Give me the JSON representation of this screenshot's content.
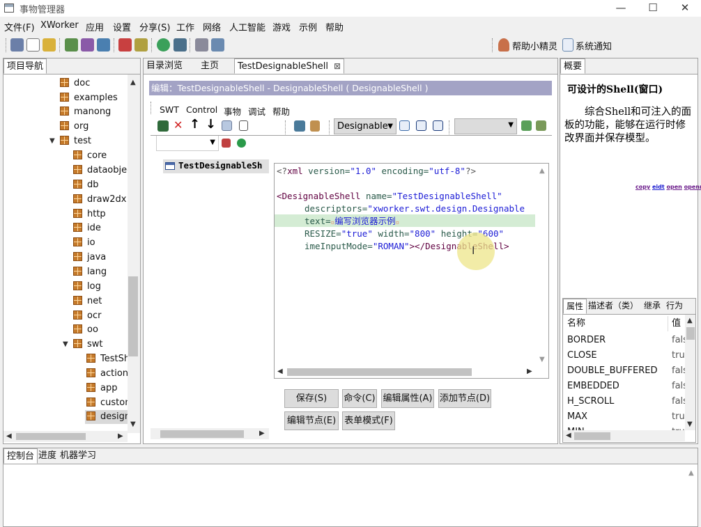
{
  "app_title": "事物管理器",
  "window_controls": {
    "minimize": "—",
    "maximize": "☐",
    "close": "✕"
  },
  "menu": [
    "文件(F)",
    "XWorker",
    "应用",
    "设置",
    "分享(S)",
    "工作",
    "网络",
    "人工智能",
    "游戏",
    "示例",
    "帮助"
  ],
  "toolbar_right": {
    "helper": "帮助小精灵",
    "notify": "系统通知"
  },
  "left_panel": {
    "tab": "项目导航",
    "tree": [
      "doc",
      "examples",
      "manong",
      "org",
      "test",
      "core",
      "dataobjec",
      "db",
      "draw2dx",
      "http",
      "ide",
      "io",
      "java",
      "lang",
      "log",
      "net",
      "ocr",
      "oo",
      "swt",
      "TestSh",
      "actions",
      "app",
      "custon",
      "design"
    ]
  },
  "center": {
    "tabs": [
      "目录浏览",
      "主页",
      "TestDesignableShell"
    ],
    "edit_header": "编辑：TestDesignableShell - DesignableShell ( DesignableShell )",
    "editor_menu": [
      "SWT",
      "Control",
      "事物",
      "调试",
      "帮助"
    ],
    "combo_value": "Designable",
    "outline_node": "TestDesignableSh",
    "xml_lines": {
      "l1": [
        "<?",
        "xml",
        " version=",
        "\"1.0\"",
        " encoding=",
        "\"utf-8\"",
        "?>"
      ],
      "l2_tag": "<DesignableShell",
      "l2_attr": " name=",
      "l2_val": "\"TestDesignableShell\"",
      "l3_attr": "descriptors=",
      "l3_val": "\"xworker.swt.design.Designable",
      "l4_attr": "text=",
      "l4_val": "编写浏览器示例",
      "l5_attr1": "RESIZE=",
      "l5_val1": "\"true\"",
      "l5_attr2": " width=",
      "l5_val2": "\"800\"",
      "l5_attr3": " height=",
      "l5_val3": "\"600\"",
      "l6_attr": "imeInputMode=",
      "l6_val": "\"ROMAN\"",
      "l6_close": "></DesignableShell>"
    },
    "buttons": {
      "save": "保存(S)",
      "command": "命令(C)",
      "edit_props": "编辑属性(A)",
      "add_node": "添加节点(D)",
      "edit_node": "编辑节点(E)",
      "form_mode": "表单模式(F)"
    }
  },
  "right_panel": {
    "tab": "概要",
    "title": "可设计的Shell(窗口)",
    "description": "综合Shell和可注入的面板的功能，能够在运行时修改界面并保存模型。",
    "links": [
      "copy",
      "eidt",
      "open",
      "openr"
    ],
    "prop_tabs": [
      "属性",
      "描述者（类）",
      "继承",
      "行为"
    ],
    "prop_headers": {
      "name": "名称",
      "value": "值"
    },
    "props": [
      {
        "name": "BORDER",
        "value": "false"
      },
      {
        "name": "CLOSE",
        "value": "true"
      },
      {
        "name": "DOUBLE_BUFFERED",
        "value": "false"
      },
      {
        "name": "EMBEDDED",
        "value": "false"
      },
      {
        "name": "H_SCROLL",
        "value": "false"
      },
      {
        "name": "MAX",
        "value": "true"
      },
      {
        "name": "MIN",
        "value": "true"
      }
    ]
  },
  "bottom_panel": {
    "tabs": [
      "控制台",
      "进度",
      "机器学习"
    ]
  },
  "colors": {
    "edit_header_bg": "#a3a3c5",
    "highlight_line": "#d4ecd4",
    "tag": "#600040",
    "string": "#1b1bd6",
    "cursor_circle": "#ede68a"
  }
}
